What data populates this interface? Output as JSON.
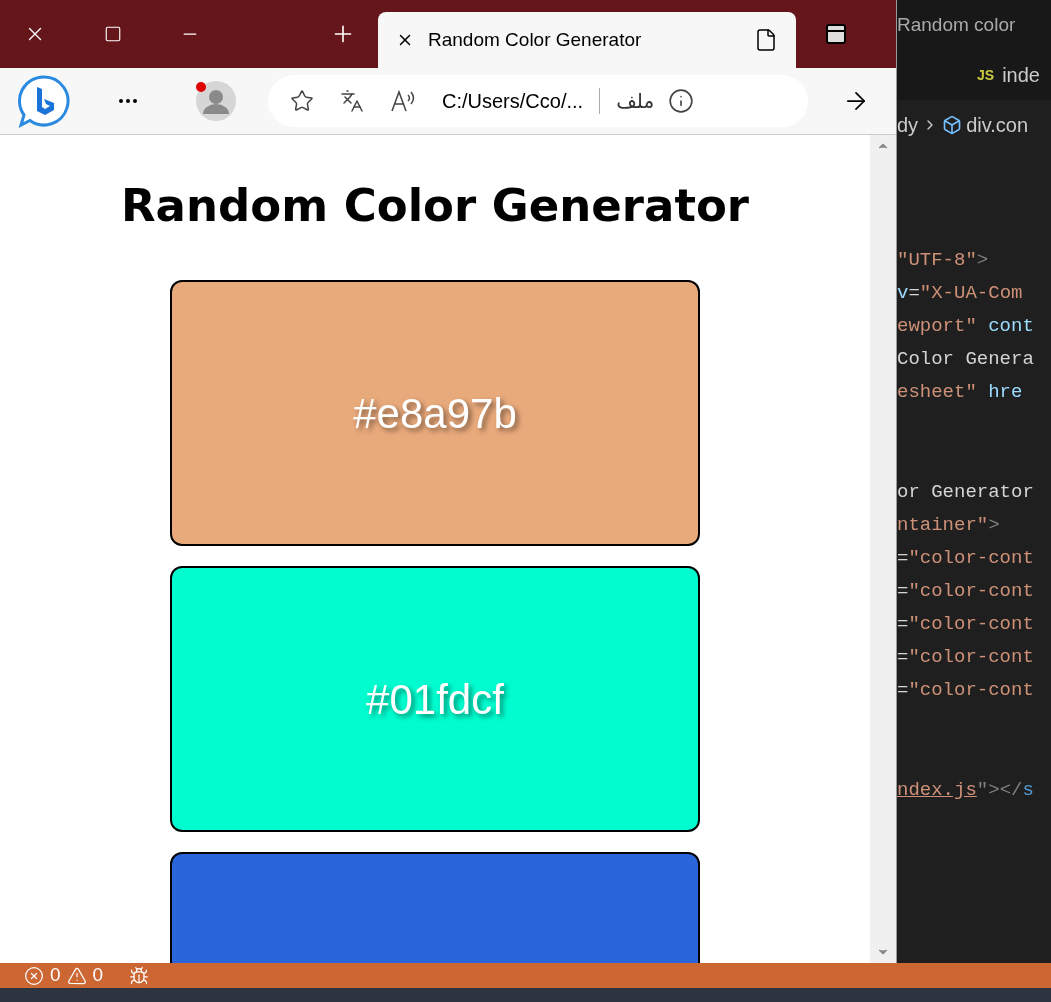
{
  "browser": {
    "tab": {
      "title": "Random Color Generator",
      "selected": true
    },
    "address_bar": {
      "url": "C:/Users/Cco/...",
      "scheme_label": "ملف"
    },
    "page": {
      "heading": "Random Color Generator",
      "colors": [
        {
          "hex": "#e8a97b",
          "color": "#e8a97b"
        },
        {
          "hex": "#01fdcf",
          "color": "#01fdcf"
        },
        {
          "color": "#2a65dc"
        }
      ]
    }
  },
  "editor": {
    "title": "Random color",
    "tab": {
      "badge": "JS",
      "label": "inde"
    },
    "breadcrumb": [
      "dy",
      "div.con"
    ],
    "code_blocks": [
      {
        "lines": [
          [
            {
              "text": "\"UTF-8\"",
              "kind": "string"
            },
            {
              "text": ">",
              "kind": "punct"
            }
          ],
          [
            {
              "text": "v",
              "kind": "attr"
            },
            {
              "text": "=",
              "kind": "text"
            },
            {
              "text": "\"X-UA-Com",
              "kind": "string"
            }
          ],
          [
            {
              "text": "ewport\" ",
              "kind": "string"
            },
            {
              "text": "cont",
              "kind": "attr"
            }
          ],
          [
            {
              "text": "Color Genera",
              "kind": "text"
            }
          ],
          [
            {
              "text": "esheet\" ",
              "kind": "string"
            },
            {
              "text": "hre",
              "kind": "attr"
            }
          ]
        ]
      },
      {
        "lines": [
          [
            {
              "text": "or Generator",
              "kind": "text"
            }
          ],
          [
            {
              "text": "ntainer\"",
              "kind": "string"
            },
            {
              "text": ">",
              "kind": "punct"
            }
          ],
          [
            {
              "text": "=",
              "kind": "text"
            },
            {
              "text": "\"color-cont",
              "kind": "string"
            }
          ],
          [
            {
              "text": "=",
              "kind": "text"
            },
            {
              "text": "\"color-cont",
              "kind": "string"
            }
          ],
          [
            {
              "text": "=",
              "kind": "text"
            },
            {
              "text": "\"color-cont",
              "kind": "string"
            }
          ],
          [
            {
              "text": "=",
              "kind": "text"
            },
            {
              "text": "\"color-cont",
              "kind": "string"
            }
          ],
          [
            {
              "text": "=",
              "kind": "text"
            },
            {
              "text": "\"color-cont",
              "kind": "string"
            }
          ]
        ]
      },
      {
        "lines": [
          [
            {
              "text": "ndex.js",
              "kind": "link"
            },
            {
              "text": "\"></",
              "kind": "punct"
            },
            {
              "text": "s",
              "kind": "tag"
            }
          ]
        ]
      }
    ]
  },
  "status_bar": {
    "errors": "0",
    "warnings": "0"
  }
}
